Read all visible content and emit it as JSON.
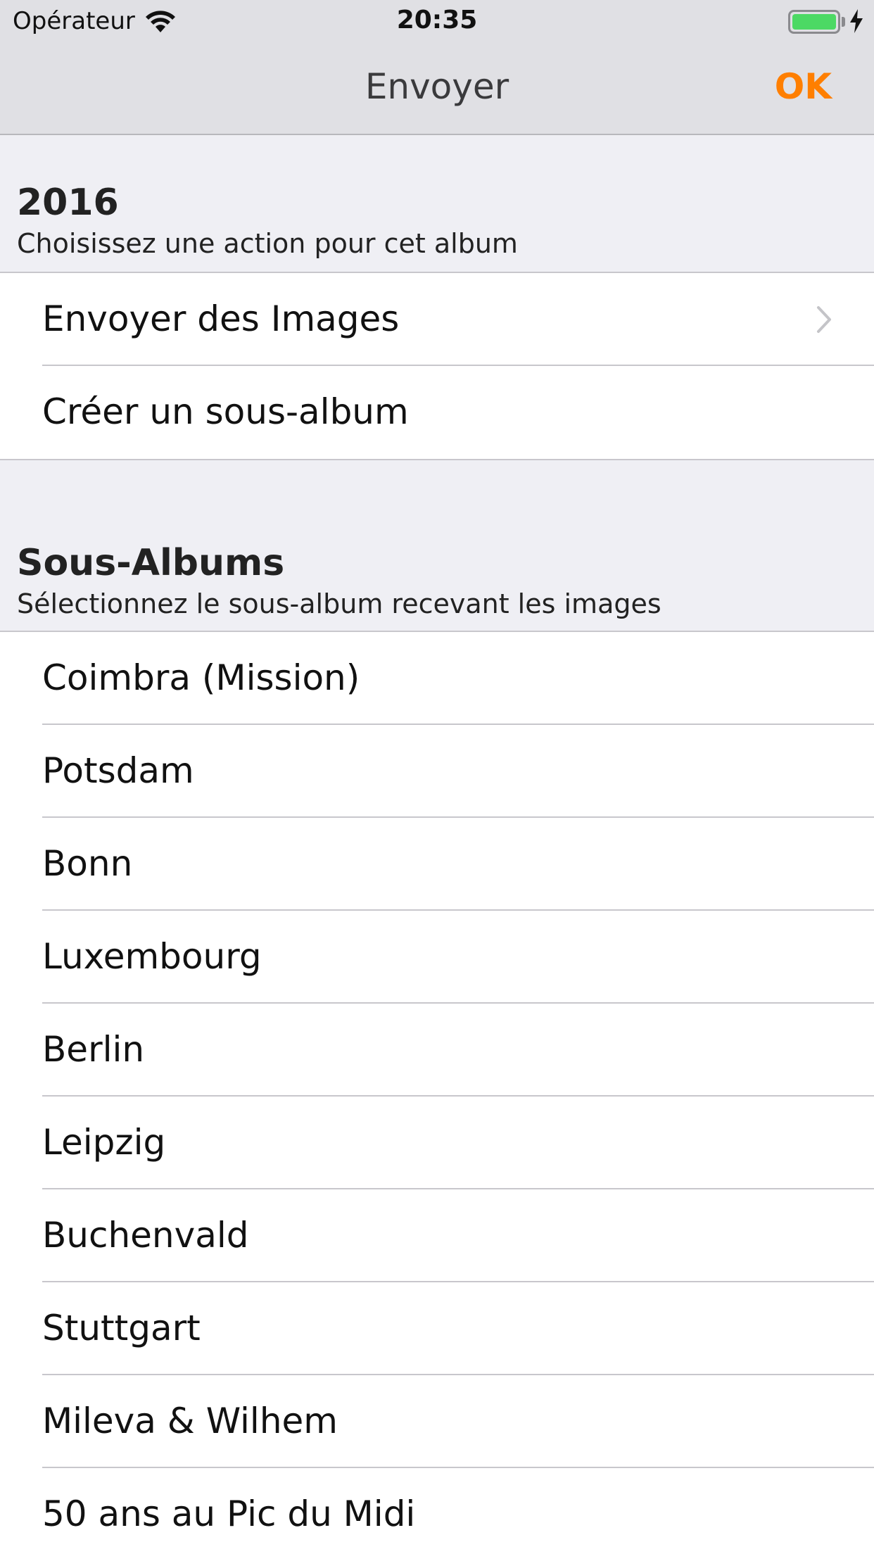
{
  "status_bar": {
    "carrier": "Opérateur",
    "time": "20:35",
    "battery_color": "#4cd964"
  },
  "nav": {
    "title": "Envoyer",
    "ok_label": "OK",
    "accent_color": "#ff7f00"
  },
  "actions_section": {
    "title": "2016",
    "subtitle": "Choisissez une action pour cet album",
    "items": [
      {
        "label": "Envoyer des Images",
        "icon": "chevron-right-icon"
      },
      {
        "label": "Créer un sous-album"
      }
    ]
  },
  "subalbums_section": {
    "title": "Sous-Albums",
    "subtitle": "Sélectionnez le sous-album recevant les images",
    "items": [
      {
        "label": "Coimbra (Mission)"
      },
      {
        "label": "Potsdam"
      },
      {
        "label": "Bonn"
      },
      {
        "label": "Luxembourg"
      },
      {
        "label": "Berlin"
      },
      {
        "label": "Leipzig"
      },
      {
        "label": "Buchenvald"
      },
      {
        "label": "Stuttgart"
      },
      {
        "label": "Mileva & Wilhem"
      },
      {
        "label": "50 ans au Pic du Midi"
      }
    ]
  }
}
